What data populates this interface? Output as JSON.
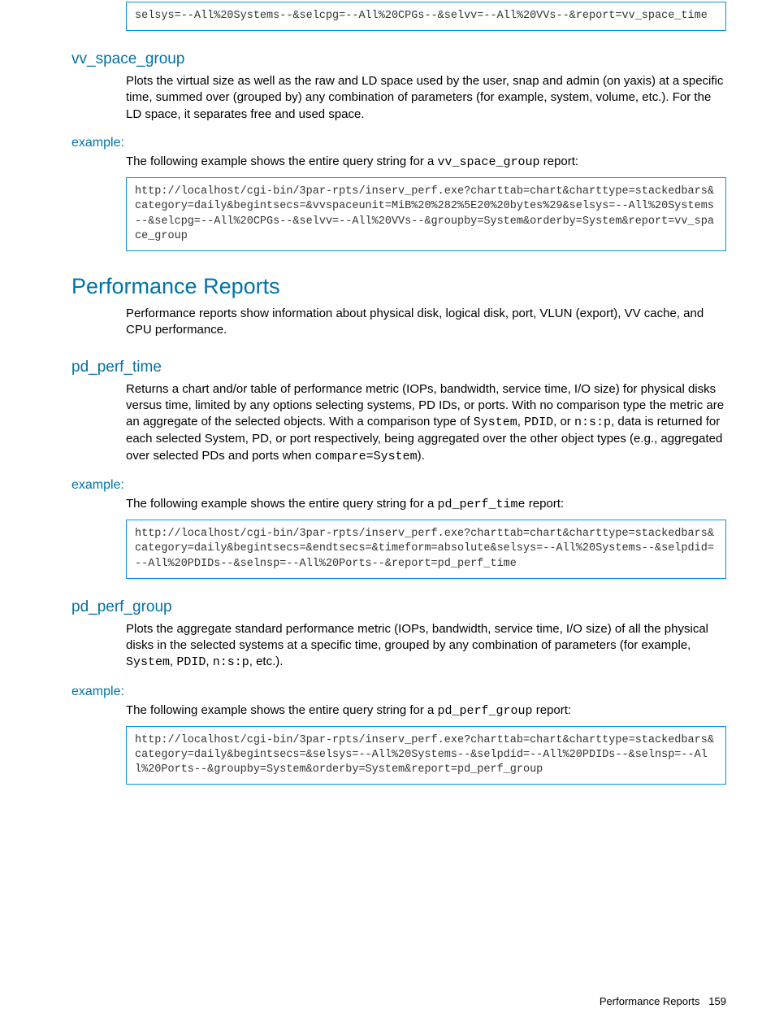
{
  "codeBlock1": "selsys=--All%20Systems--&selcpg=--All%20CPGs--&selvv=--All%20VVs--&report=vv_space_time",
  "vvSpaceGroup": {
    "heading": "vv_space_group",
    "body": "Plots the virtual size as well as the raw and LD space used by the user, snap and admin (on yaxis) at a specific time, summed over (grouped by) any combination of parameters (for example, system, volume, etc.). For the LD space, it separates free and used space.",
    "exampleLabel": "example:",
    "exampleIntro1": "The following example shows the entire query string for a ",
    "exampleMono": "vv_space_group",
    "exampleIntro2": " report:",
    "code": "http://localhost/cgi-bin/3par-rpts/inserv_perf.exe?charttab=chart&charttype=stackedbars&category=daily&begintsecs=&vvspaceunit=MiB%20%282%5E20%20bytes%29&selsys=--All%20Systems--&selcpg=--All%20CPGs--&selvv=--All%20VVs--&groupby=System&orderby=System&report=vv_space_group"
  },
  "perfReports": {
    "heading": "Performance Reports",
    "body": "Performance reports show information about physical disk, logical disk, port, VLUN (export), VV cache, and CPU performance."
  },
  "pdPerfTime": {
    "heading": "pd_perf_time",
    "body1": "Returns a chart and/or table of performance metric (IOPs, bandwidth, service time, I/O size) for physical disks versus time, limited by any options selecting systems, PD IDs, or ports. With no comparison type the metric are an aggregate of the selected objects. With a comparison type of ",
    "mono1": "System",
    "mid1": ", ",
    "mono2": "PDID",
    "mid2": ", or ",
    "mono3": "n:s:p",
    "body2": ", data is returned for each selected System, PD, or port respectively, being aggregated over the other object types (e.g., aggregated over selected PDs and ports when ",
    "mono4": "compare=System",
    "body3": ").",
    "exampleLabel": "example:",
    "exampleIntro1": "The following example shows the entire query string for a ",
    "exampleMono": "pd_perf_time",
    "exampleIntro2": " report:",
    "code": "http://localhost/cgi-bin/3par-rpts/inserv_perf.exe?charttab=chart&charttype=stackedbars&category=daily&begintsecs=&endtsecs=&timeform=absolute&selsys=--All%20Systems--&selpdid=--All%20PDIDs--&selnsp=--All%20Ports--&report=pd_perf_time"
  },
  "pdPerfGroup": {
    "heading": "pd_perf_group",
    "body1": "Plots the aggregate standard performance metric (IOPs, bandwidth, service time, I/O size) of all the physical disks in the selected systems at a specific time, grouped by any combination of parameters (for example, ",
    "mono1": "System",
    "mid1": ", ",
    "mono2": "PDID",
    "mid2": ", ",
    "mono3": "n:s:p",
    "body2": ", etc.).",
    "exampleLabel": "example:",
    "exampleIntro1": "The following example shows the entire query string for a ",
    "exampleMono": "pd_perf_group",
    "exampleIntro2": " report:",
    "code": "http://localhost/cgi-bin/3par-rpts/inserv_perf.exe?charttab=chart&charttype=stackedbars&category=daily&begintsecs=&selsys=--All%20Systems--&selpdid=--All%20PDIDs--&selnsp=--All%20Ports--&groupby=System&orderby=System&report=pd_perf_group"
  },
  "footer": {
    "label": "Performance Reports",
    "page": "159"
  }
}
